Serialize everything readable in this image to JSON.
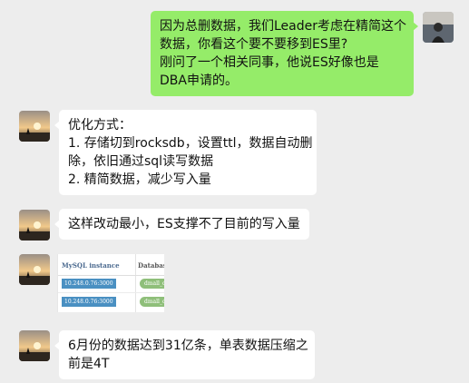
{
  "messages": [
    {
      "side": "right",
      "lines": [
        "因为总删数据，我们Leader考虑在精简这个",
        "数据，你看这个要不要移到ES里?",
        "刚问了一个相关同事，他说ES好像也是",
        "DBA申请的。"
      ]
    },
    {
      "side": "left",
      "lines": [
        "优化方式：",
        "1. 存储切到rocksdb，设置ttl，数据自动删",
        "除，依旧通过sql读写数据",
        "2. 精简数据，减少写入量"
      ]
    },
    {
      "side": "left",
      "lines": [
        "这样改动最小，ES支撑不了目前的写入量"
      ]
    },
    {
      "side": "left",
      "type": "image",
      "image": {
        "col1": "MySQL instance",
        "col2": "Database",
        "rows": [
          {
            "ip": "10.248.0.76:3000",
            "db": "dmall_da"
          },
          {
            "ip": "10.248.0.76:3000",
            "db": "dmall_da"
          }
        ]
      }
    },
    {
      "side": "left",
      "lines": [
        "6月份的数据达到31亿条，单表数据压缩之",
        "前是4T"
      ]
    }
  ]
}
